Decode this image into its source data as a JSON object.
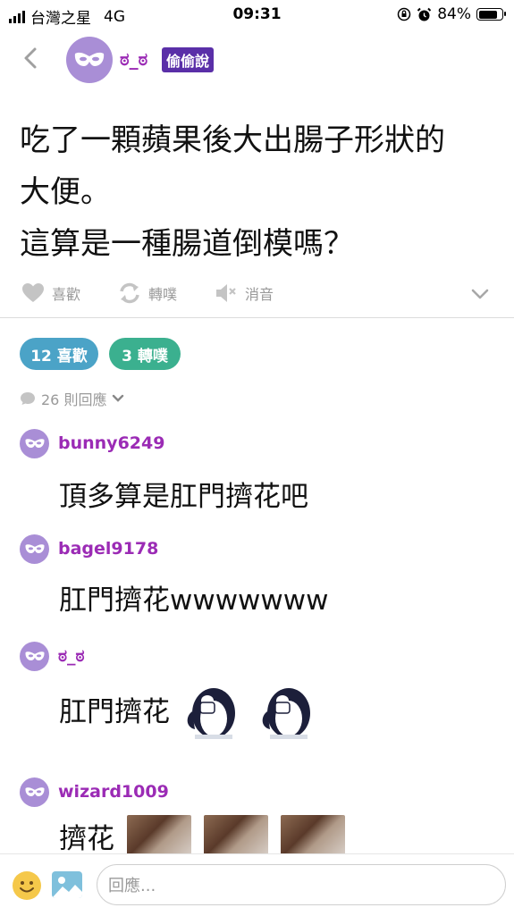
{
  "status_bar": {
    "carrier": "台灣之星",
    "network": "4G",
    "time": "09:31",
    "battery": "84%",
    "battery_level": 0.84
  },
  "header": {
    "author": "ಠ_ಠ",
    "badge": "偷偷說"
  },
  "post": {
    "lines": [
      "吃了一顆蘋果後大出腸子形狀的",
      "大便。",
      "這算是一種腸道倒模嗎？"
    ]
  },
  "actions": {
    "like": "喜歡",
    "share": "轉噗",
    "mute": "消音"
  },
  "stats": {
    "likes": "12 喜歡",
    "shares": "3 轉噗",
    "replies": "26 則回應"
  },
  "comments": [
    {
      "name": "bunny6249",
      "text": "頂多算是肛門擠花吧"
    },
    {
      "name": "bagel9178",
      "text": "肛門擠花wwwwwww"
    },
    {
      "name": "ಠ_ಠ",
      "text": "肛門擠花"
    },
    {
      "name": "wizard1009",
      "text": "擠花"
    }
  ],
  "reply_box": {
    "placeholder": "回應..."
  },
  "colors": {
    "accent_purple": "#9b2bb5",
    "badge_bg": "#5a2fa8",
    "likes_pill": "#4ba3c7",
    "shares_pill": "#3bb08f",
    "avatar": "#a98ed6"
  }
}
